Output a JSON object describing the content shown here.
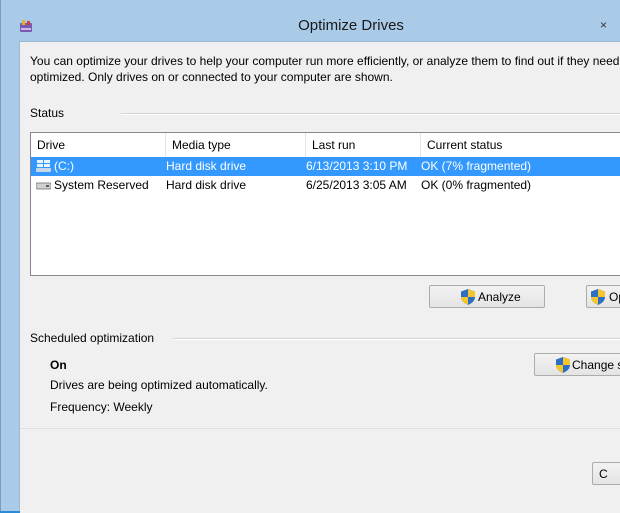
{
  "window": {
    "title": "Optimize Drives",
    "close_glyph": "×",
    "app_icon": "optimize-drives-app-icon"
  },
  "description": {
    "line1": "You can optimize your drives to help your computer run more efficiently, or analyze them to find out if they need to be",
    "line2": "optimized. Only drives on or connected to your computer are shown."
  },
  "status": {
    "section_label": "Status",
    "columns": [
      "Drive",
      "Media type",
      "Last run",
      "Current status"
    ],
    "drives": [
      {
        "name": "(C:)",
        "media_type": "Hard disk drive",
        "last_run": "6/13/2013 3:10 PM",
        "current_status": "OK (7% fragmented)",
        "icon": "windows-drive-icon",
        "selected": true
      },
      {
        "name": "System Reserved",
        "media_type": "Hard disk drive",
        "last_run": "6/25/2013 3:05 AM",
        "current_status": "OK (0% fragmented)",
        "icon": "hard-drive-icon",
        "selected": false
      }
    ],
    "analyze_label": "Analyze",
    "optimize_label": "Opti"
  },
  "scheduled": {
    "section_label": "Scheduled optimization",
    "state": "On",
    "description": "Drives are being optimized automatically.",
    "frequency": "Frequency: Weekly",
    "change_settings_label": "Change se"
  },
  "footer": {
    "close_label": "C"
  },
  "colors": {
    "selection": "#3399ff",
    "window_frame": "#a9cbe8",
    "desktop": "#2b8ad6"
  }
}
